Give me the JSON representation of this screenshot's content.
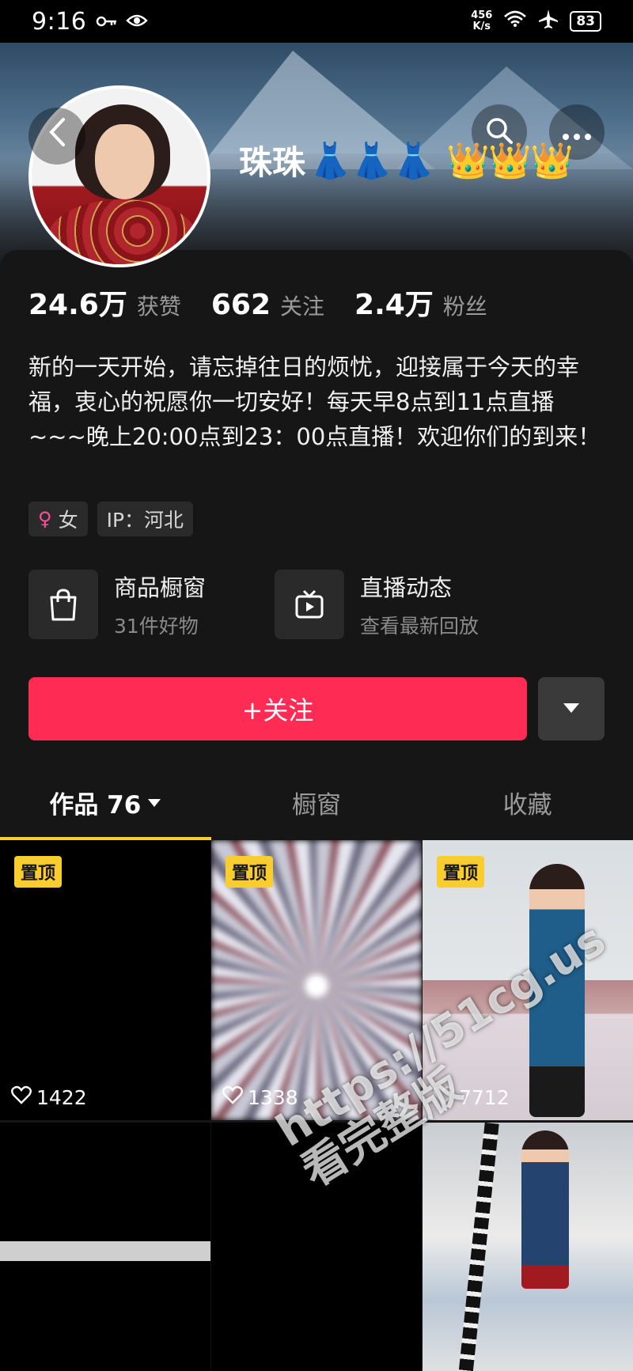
{
  "status_bar": {
    "time": "9:16",
    "left_icons": [
      "key-icon",
      "eye-icon"
    ],
    "net_speed_value": "456",
    "net_speed_unit": "K/s",
    "right_icons": [
      "wifi-icon",
      "airplane-icon"
    ],
    "battery": "83"
  },
  "header": {
    "username": "珠珠",
    "decorations_dresses": "👗👗👗",
    "decorations_crowns": "👑👑👑",
    "back_icon": "chevron-left-icon",
    "search_icon": "search-icon",
    "more_icon": "more-icon"
  },
  "stats": [
    {
      "value": "24.6万",
      "label": "获赞"
    },
    {
      "value": "662",
      "label": "关注"
    },
    {
      "value": "2.4万",
      "label": "粉丝"
    }
  ],
  "bio": "新的一天开始，请忘掉往日的烦忧，迎接属于今天的幸福，衷心的祝愿你一切安好！每天早8点到11点直播~~~晚上20:00点到23：00点直播！欢迎你们的到来！",
  "tags": {
    "gender": "女",
    "ip": "IP：河北"
  },
  "entries": [
    {
      "title": "商品橱窗",
      "subtitle": "31件好物",
      "icon": "shopping-bag-icon"
    },
    {
      "title": "直播动态",
      "subtitle": "查看最新回放",
      "icon": "tv-icon"
    }
  ],
  "follow_button": "+关注",
  "tabs": [
    {
      "label": "作品 76",
      "active": true
    },
    {
      "label": "橱窗",
      "active": false
    },
    {
      "label": "收藏",
      "active": false
    }
  ],
  "videos": [
    {
      "pinned_label": "置顶",
      "likes": "1422"
    },
    {
      "pinned_label": "置顶",
      "likes": "1338"
    },
    {
      "pinned_label": "置顶",
      "likes": "7712"
    }
  ],
  "watermark": {
    "url": "https://51cg.us",
    "text": "看完整版"
  },
  "colors": {
    "accent": "#fe2c55",
    "tab_indicator": "#facd2e",
    "pin_badge": "#facd2e",
    "background": "#161616"
  }
}
